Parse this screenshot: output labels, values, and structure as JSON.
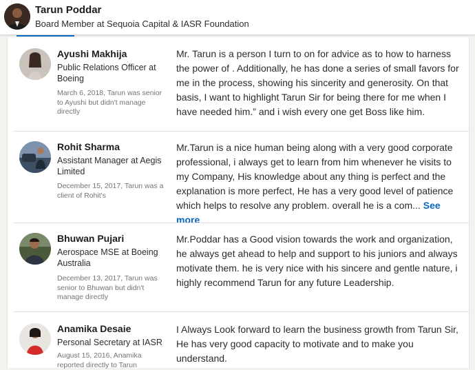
{
  "profile": {
    "name": "Tarun Poddar",
    "headline": "Board Member at Sequoia Capital & IASR Foundation"
  },
  "recommendations": [
    {
      "name": "Ayushi Makhija",
      "role": "Public Relations Officer at Boeing",
      "meta": "March 6, 2018, Tarun was senior to Ayushi but didn't manage directly",
      "text": "Mr. Tarun is a person I turn to on for advice as to how to harness the power of . Additionally, he has done a series of small favors for me in the process, showing his sincerity and generosity. On that basis, I want to highlight Tarun Sir for being there for me when I have needed him.” and i wish every one get Boss like him."
    },
    {
      "name": "Rohit Sharma",
      "role": "Assistant Manager at Aegis Limited",
      "meta": "December 15, 2017, Tarun was a client of Rohit's",
      "text": "Mr.Tarun is a nice human being along with a very good corporate professional, i always get to learn from him whenever he visits to my Company, His knowledge about any thing is perfect and the explanation is more perfect, He has a very good level of patience which helps to resolve any problem. overall he is a com...",
      "see_more": "See more"
    },
    {
      "name": "Bhuwan Pujari",
      "role": "Aerospace MSE at Boeing Australia",
      "meta": "December 13, 2017, Tarun was senior to Bhuwan but didn't manage directly",
      "text": "Mr.Poddar has a Good vision towards the work and organization, he always get ahead to help and support to his juniors and always motivate them. he is very nice with his sincere and gentle nature, i highly recommend Tarun for any future Leadership."
    },
    {
      "name": "Anamika Desaie",
      "role": "Personal Secretary at IASR",
      "meta": "August 15, 2016, Anamika reported directly to Tarun",
      "text": "I Always Look forward to learn the business growth from Tarun Sir, He has very good capacity to motivate and to make you understand."
    }
  ]
}
